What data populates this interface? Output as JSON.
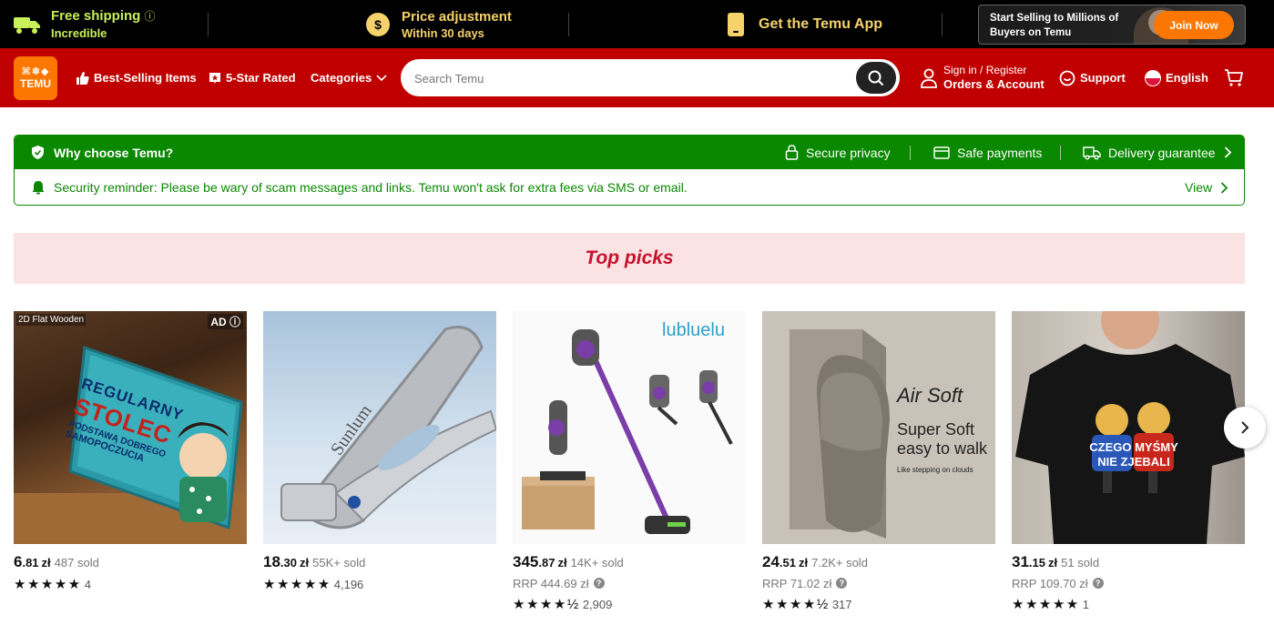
{
  "promo": {
    "shipping_title": "Free shipping",
    "shipping_sub": "Incredible",
    "price_title": "Price adjustment",
    "price_sub": "Within 30 days",
    "app_text": "Get the Temu App",
    "seller_text": "Start Selling to Millions of Buyers on Temu",
    "join_label": "Join Now"
  },
  "header": {
    "logo_glyphs": "⌘✽◆",
    "logo_text": "TEMU",
    "nav": [
      "Best-Selling Items",
      "5-Star Rated",
      "Categories"
    ],
    "search_placeholder": "Search Temu",
    "signin": "Sign in / Register",
    "orders": "Orders & Account",
    "support": "Support",
    "language": "English"
  },
  "why": {
    "title": "Why choose Temu?",
    "features": [
      "Secure privacy",
      "Safe payments",
      "Delivery guarantee"
    ],
    "reminder": "Security reminder: Please be wary of scam messages and links. Temu won't ask for extra fees via SMS or email.",
    "view": "View"
  },
  "picks": {
    "title": "Top picks"
  },
  "products": [
    {
      "int": "6",
      "dec": ".81",
      "cur": "zł",
      "sold": "487 sold",
      "rrp": "",
      "rating": "★★★★★",
      "reviews": "4",
      "tag": "2D Flat Wooden",
      "ad": "AD ⓘ",
      "sign_line1": "REGULARNY",
      "sign_line2": "STOLEC",
      "sign_line3": "PODSTAWĄ DOBREGO",
      "sign_line4": "SAMOPOCZUCIA"
    },
    {
      "int": "18",
      "dec": ".30",
      "cur": "zł",
      "sold": "55K+ sold",
      "rrp": "",
      "rating": "★★★★★",
      "reviews": "4,196",
      "brand": "Sunlum"
    },
    {
      "int": "345",
      "dec": ".87",
      "cur": "zł",
      "sold": "14K+ sold",
      "rrp": "RRP 444.69 zł",
      "rating": "★★★★½",
      "reviews": "2,909",
      "brand": "lubluelu"
    },
    {
      "int": "24",
      "dec": ".51",
      "cur": "zł",
      "sold": "7.2K+ sold",
      "rrp": "RRP 71.02 zł",
      "rating": "★★★★½",
      "reviews": "317",
      "line1": "Air Soft",
      "line2": "Super Soft",
      "line3": "easy to walk",
      "line4": "Like stepping on clouds"
    },
    {
      "int": "31",
      "dec": ".15",
      "cur": "zł",
      "sold": "51 sold",
      "rrp": "RRP 109.70 zł",
      "rating": "★★★★★",
      "reviews": "1",
      "shirt1": "CZEGO MYŚMY",
      "shirt2": "NIE ZJEBALI"
    }
  ],
  "colors": {
    "header_red": "#c00000",
    "temu_orange": "#fb7701",
    "green": "#0a8800",
    "promo_green": "#c8f05a",
    "promo_yellow": "#f5d26b"
  }
}
